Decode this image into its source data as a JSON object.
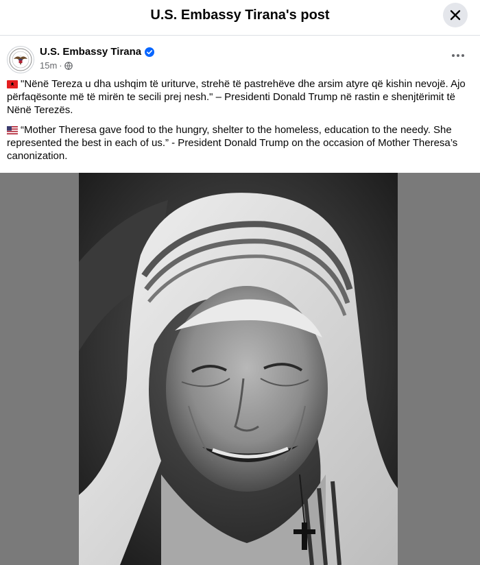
{
  "header": {
    "title": "U.S. Embassy Tirana's post",
    "close_icon": "close-icon"
  },
  "post": {
    "author": "U.S. Embassy Tirana",
    "verified_icon": "verified-badge-icon",
    "time": "15m",
    "separator": "·",
    "audience_icon": "globe-icon",
    "more_icon": "more-options-icon",
    "albanian_flag_icon": "albania-flag-icon",
    "albanian_text": "\"Nënë Tereza u dha ushqim të uriturve, strehë të pastrehëve dhe arsim atyre që kishin nevojë. Ajo përfaqësonte më të mirën te secili prej nesh.\" – Presidenti Donald Trump në rastin e shenjtërimit të Nënë Terezës.",
    "us_flag_icon": "us-flag-icon",
    "english_text": "“Mother Theresa gave food to the hungry, shelter to the homeless, education to the needy.  She represented the best in each of us.” - President Donald Trump on the occasion of Mother Theresa’s canonization."
  },
  "colors": {
    "primary_text": "#050505",
    "secondary_text": "#65676b",
    "verified_blue": "#0866ff",
    "close_button_bg": "#e4e6eb",
    "photo_backdrop": "#7a7a7a"
  }
}
